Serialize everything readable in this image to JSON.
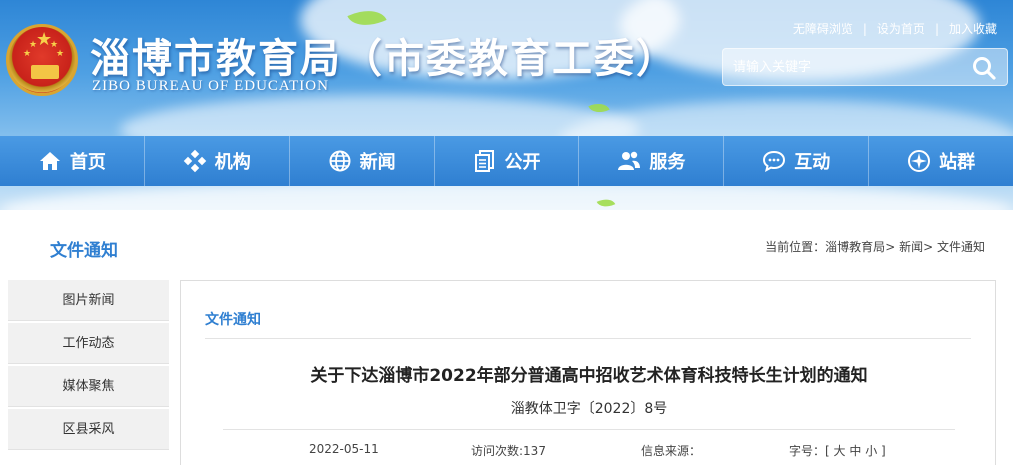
{
  "header": {
    "title": "淄博市教育局（市委教育工委）",
    "subtitle": "ZIBO BUREAU OF EDUCATION",
    "toplinks": [
      "无障碍浏览",
      "设为首页",
      "加入收藏"
    ],
    "search": {
      "placeholder": "请输入关键字"
    }
  },
  "nav": {
    "items": [
      {
        "label": "首页",
        "icon": "home-icon"
      },
      {
        "label": "机构",
        "icon": "organization-icon"
      },
      {
        "label": "新闻",
        "icon": "globe-icon"
      },
      {
        "label": "公开",
        "icon": "documents-icon"
      },
      {
        "label": "服务",
        "icon": "people-icon"
      },
      {
        "label": "互动",
        "icon": "chat-icon"
      },
      {
        "label": "站群",
        "icon": "compass-icon"
      }
    ]
  },
  "page": {
    "section_title": "文件通知",
    "breadcrumb": {
      "prefix": "当前位置：",
      "items": [
        "淄博教育局",
        "新闻",
        "文件通知"
      ],
      "separator": ">"
    }
  },
  "sidebar": {
    "items": [
      "图片新闻",
      "工作动态",
      "媒体聚焦",
      "区县采风"
    ]
  },
  "article": {
    "category": "文件通知",
    "title": "关于下达淄博市2022年部分普通高中招收艺术体育科技特长生计划的通知",
    "doc_number": "淄教体卫字〔2022〕8号",
    "date": "2022-05-11",
    "visits_label": "访问次数:",
    "visits": "137",
    "source_label": "信息来源：",
    "source": "",
    "font_size_label": "字号：[",
    "font_sizes": [
      "大",
      "中",
      "小"
    ],
    "font_size_close": "]"
  },
  "colors": {
    "accent": "#2f7fd1",
    "nav_background": "#3a8bdb",
    "sidebar_background": "#f1f1f1"
  }
}
